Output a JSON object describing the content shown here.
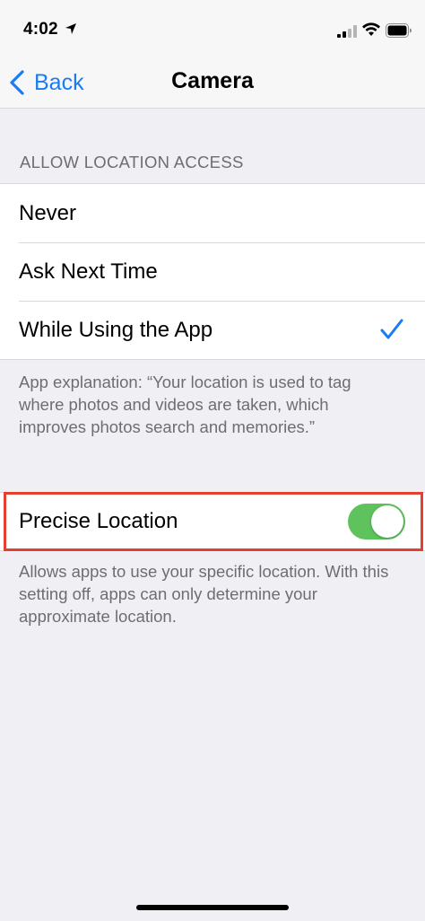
{
  "status_bar": {
    "time": "4:02"
  },
  "nav": {
    "back_label": "Back",
    "title": "Camera"
  },
  "location_access": {
    "header": "ALLOW LOCATION ACCESS",
    "options": [
      {
        "label": "Never",
        "selected": false
      },
      {
        "label": "Ask Next Time",
        "selected": false
      },
      {
        "label": "While Using the App",
        "selected": true
      }
    ],
    "explanation": "App explanation: “Your location is used to tag where photos and videos are taken, which improves photos search and memories.”"
  },
  "precise_location": {
    "label": "Precise Location",
    "enabled": true,
    "footer": "Allows apps to use your specific location. With this setting off, apps can only determine your approximate location."
  },
  "colors": {
    "accent": "#1a7cf4",
    "toggle_on": "#5ec35d",
    "highlight": "#e3402f",
    "background": "#efeff4"
  },
  "icons": {
    "location": "location-arrow-icon",
    "signal": "cellular-signal-icon",
    "wifi": "wifi-icon",
    "battery": "battery-icon",
    "back": "chevron-left-icon",
    "check": "checkmark-icon"
  }
}
